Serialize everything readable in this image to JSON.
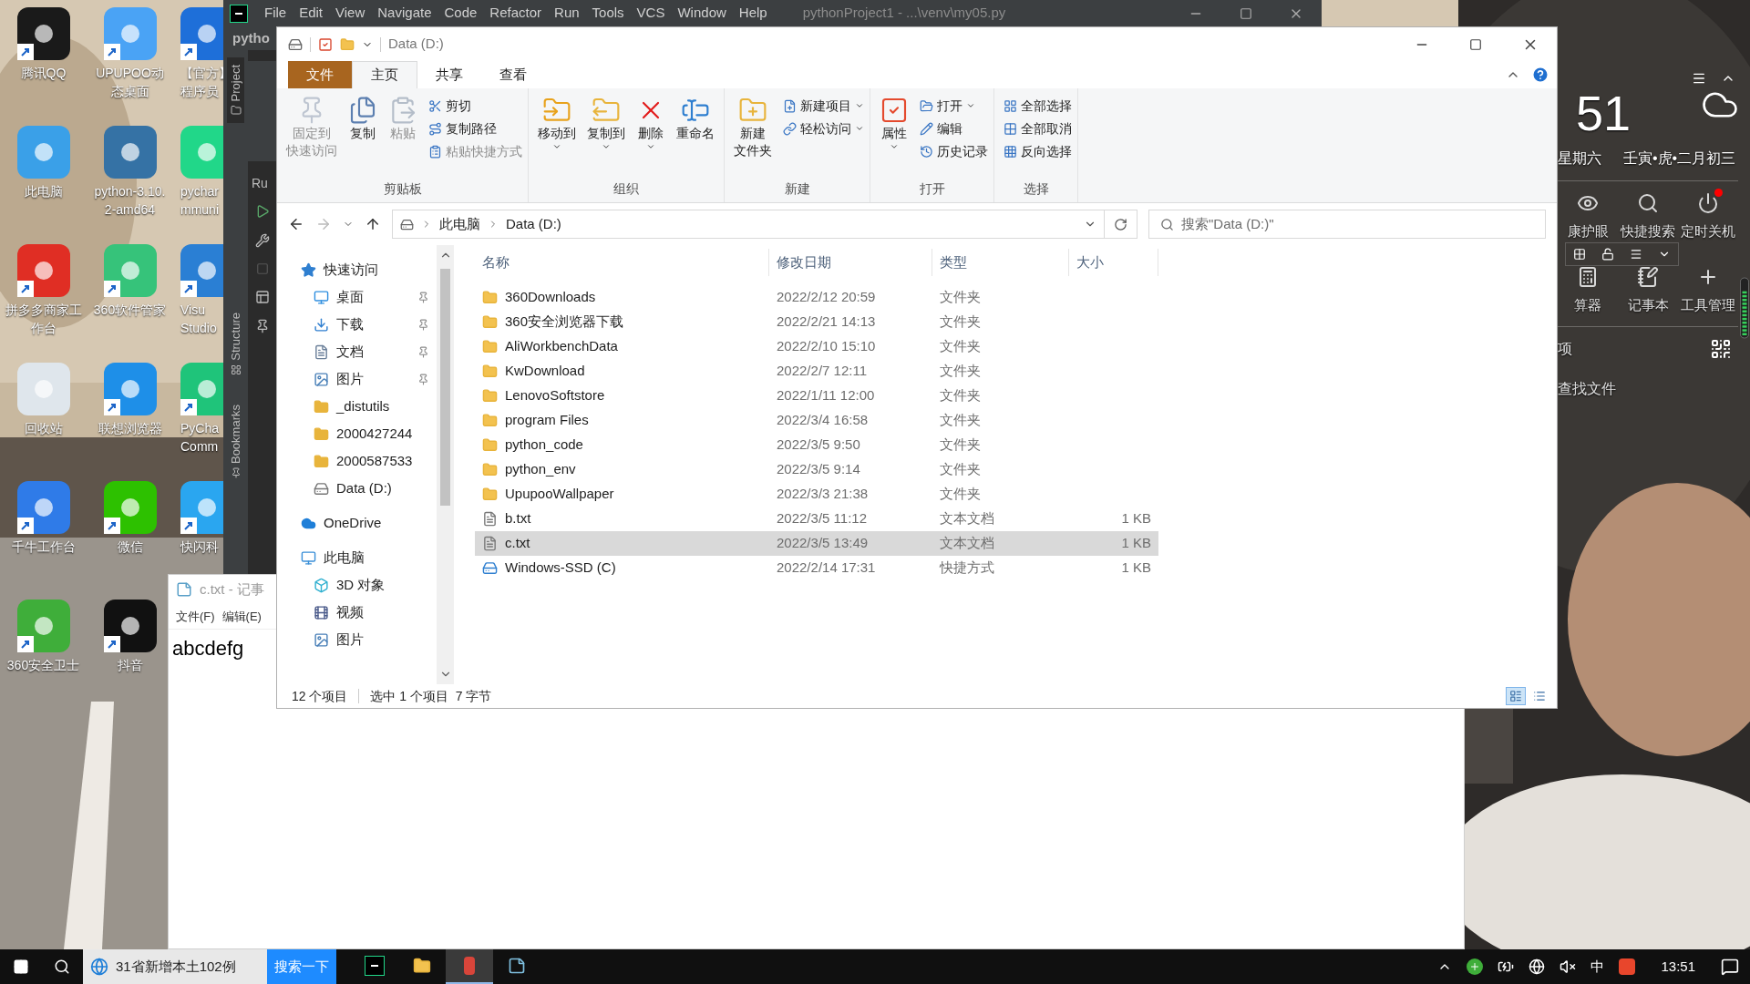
{
  "desktop": {
    "columns": [
      [
        {
          "lines": [
            "腾讯QQ"
          ],
          "color": "#1a1a1a",
          "shortcut": true
        },
        {
          "lines": [
            "此电脑"
          ],
          "color": "#3aa0e8",
          "shortcut": false
        },
        {
          "lines": [
            "拼多多商家工",
            "作台"
          ],
          "color": "#e02e24",
          "shortcut": true
        },
        {
          "lines": [
            "回收站"
          ],
          "color": "#dfe6ec",
          "shortcut": false
        },
        {
          "lines": [
            "千牛工作台"
          ],
          "color": "#2f7be8",
          "shortcut": true
        },
        {
          "lines": [
            "360安全卫士"
          ],
          "color": "#3fae3a",
          "shortcut": true
        }
      ],
      [
        {
          "lines": [
            "UPUPOO动",
            "态桌面"
          ],
          "color": "#4aa3f5",
          "shortcut": true
        },
        {
          "lines": [
            "python-3.10.",
            "2-amd64"
          ],
          "color": "#3572a5",
          "shortcut": false
        },
        {
          "lines": [
            "360软件管家"
          ],
          "color": "#36c37a",
          "shortcut": true
        },
        {
          "lines": [
            "联想浏览器"
          ],
          "color": "#1e8fe8",
          "shortcut": true
        },
        {
          "lines": [
            "微信"
          ],
          "color": "#2dc100",
          "shortcut": true
        },
        {
          "lines": [
            "抖音"
          ],
          "color": "#111111",
          "shortcut": true
        }
      ],
      [
        {
          "lines": [
            "【官方】",
            "程序员"
          ],
          "color": "#1e6fd9",
          "shortcut": true
        },
        {
          "lines": [
            "pychar",
            "mmuni"
          ],
          "color": "#21d789",
          "shortcut": false
        },
        {
          "lines": [
            "Visu",
            "Studio"
          ],
          "color": "#2a7fd4",
          "shortcut": true
        },
        {
          "lines": [
            "PyCha",
            "Comm"
          ],
          "color": "#1fc47a",
          "shortcut": true
        },
        {
          "lines": [
            "快闪科"
          ],
          "color": "#2aa6f0",
          "shortcut": true
        }
      ]
    ]
  },
  "pycharm": {
    "menu": [
      "File",
      "Edit",
      "View",
      "Navigate",
      "Code",
      "Refactor",
      "Run",
      "Tools",
      "VCS",
      "Window",
      "Help"
    ],
    "title": "pythonProject1 - ...\\venv\\my05.py",
    "project_tab": "pytho",
    "tool_tabs": [
      {
        "label": "Project",
        "selected": true
      },
      {
        "label": "Structure",
        "selected": false
      },
      {
        "label": "Bookmarks",
        "selected": false
      }
    ],
    "run_tab": "Ru"
  },
  "notepad": {
    "title": "c.txt - 记事",
    "menu": [
      "文件(F)",
      "编辑(E)"
    ],
    "text": "abcdefg"
  },
  "explorer": {
    "title": "Data (D:)",
    "file_tab": "文件",
    "tabs": [
      {
        "label": "主页",
        "selected": true
      },
      {
        "label": "共享",
        "selected": false
      },
      {
        "label": "查看",
        "selected": false
      }
    ],
    "ribbon": [
      {
        "label": "剪贴板",
        "large": [
          {
            "lines": [
              "固定到",
              "快速访问"
            ],
            "disabled": true,
            "dropdown": false
          },
          {
            "lines": [
              "复制"
            ],
            "disabled": false,
            "dropdown": false
          },
          {
            "lines": [
              "粘贴"
            ],
            "disabled": true,
            "dropdown": false
          }
        ],
        "small": [
          {
            "label": "剪切",
            "disabled": false,
            "dropdown": false
          },
          {
            "label": "复制路径",
            "disabled": false,
            "dropdown": false
          },
          {
            "label": "粘贴快捷方式",
            "disabled": true,
            "dropdown": false
          }
        ]
      },
      {
        "label": "组织",
        "large": [
          {
            "lines": [
              "移动到"
            ],
            "disabled": false,
            "dropdown": true
          },
          {
            "lines": [
              "复制到"
            ],
            "disabled": false,
            "dropdown": true
          },
          {
            "lines": [
              "删除"
            ],
            "disabled": false,
            "dropdown": true
          },
          {
            "lines": [
              "重命名"
            ],
            "disabled": false,
            "dropdown": false
          }
        ]
      },
      {
        "label": "新建",
        "large": [
          {
            "lines": [
              "新建",
              "文件夹"
            ],
            "disabled": false,
            "dropdown": false
          }
        ],
        "small": [
          {
            "label": "新建项目",
            "disabled": false,
            "dropdown": true
          },
          {
            "label": "轻松访问",
            "disabled": false,
            "dropdown": true
          }
        ]
      },
      {
        "label": "打开",
        "large": [
          {
            "lines": [
              "属性"
            ],
            "disabled": false,
            "dropdown": true
          }
        ],
        "small": [
          {
            "label": "打开",
            "disabled": false,
            "dropdown": true
          },
          {
            "label": "编辑",
            "disabled": false,
            "dropdown": false
          },
          {
            "label": "历史记录",
            "disabled": false,
            "dropdown": false
          }
        ]
      },
      {
        "label": "选择",
        "small": [
          {
            "label": "全部选择",
            "disabled": false,
            "dropdown": false
          },
          {
            "label": "全部取消",
            "disabled": false,
            "dropdown": false
          },
          {
            "label": "反向选择",
            "disabled": false,
            "dropdown": false
          }
        ]
      }
    ],
    "path": [
      "此电脑",
      "Data (D:)"
    ],
    "search": {
      "placeholder": "搜索\"Data (D:)\""
    },
    "nav": [
      {
        "label": "快速访问",
        "kind": "quick",
        "pinned": false,
        "children": [
          {
            "label": "桌面",
            "kind": "desktop",
            "pinned": true
          },
          {
            "label": "下载",
            "kind": "download",
            "pinned": true
          },
          {
            "label": "文档",
            "kind": "docs",
            "pinned": true
          },
          {
            "label": "图片",
            "kind": "pictures",
            "pinned": true
          },
          {
            "label": "_distutils",
            "kind": "folder",
            "pinned": false
          },
          {
            "label": "2000427244",
            "kind": "folder",
            "pinned": false
          },
          {
            "label": "2000587533",
            "kind": "folder",
            "pinned": false
          },
          {
            "label": "Data (D:)",
            "kind": "drive",
            "pinned": false
          }
        ]
      },
      {
        "label": "OneDrive",
        "kind": "cloud",
        "pinned": false
      },
      {
        "label": "此电脑",
        "kind": "pc",
        "pinned": false,
        "children": [
          {
            "label": "3D 对象",
            "kind": "objects",
            "pinned": false
          },
          {
            "label": "视频",
            "kind": "videos",
            "pinned": false
          },
          {
            "label": "图片",
            "kind": "pictures",
            "pinned": false
          }
        ]
      }
    ],
    "columns": [
      "名称",
      "修改日期",
      "类型",
      "大小"
    ],
    "rows": [
      {
        "name": "360Downloads",
        "date": "2022/2/12 20:59",
        "type": "文件夹",
        "kind": "folder",
        "selected": false
      },
      {
        "name": "360安全浏览器下载",
        "date": "2022/2/21 14:13",
        "type": "文件夹",
        "kind": "folder",
        "selected": false
      },
      {
        "name": "AliWorkbenchData",
        "date": "2022/2/10 15:10",
        "type": "文件夹",
        "kind": "folder",
        "selected": false
      },
      {
        "name": "KwDownload",
        "date": "2022/2/7 12:11",
        "type": "文件夹",
        "kind": "folder",
        "selected": false
      },
      {
        "name": "LenovoSoftstore",
        "date": "2022/1/11 12:00",
        "type": "文件夹",
        "kind": "folder",
        "selected": false
      },
      {
        "name": "program Files",
        "date": "2022/3/4 16:58",
        "type": "文件夹",
        "kind": "folder",
        "selected": false
      },
      {
        "name": "python_code",
        "date": "2022/3/5 9:50",
        "type": "文件夹",
        "kind": "folder",
        "selected": false
      },
      {
        "name": "python_env",
        "date": "2022/3/5 9:14",
        "type": "文件夹",
        "kind": "folder",
        "selected": false
      },
      {
        "name": "UpupooWallpaper",
        "date": "2022/3/3 21:38",
        "type": "文件夹",
        "kind": "folder",
        "selected": false
      },
      {
        "name": "b.txt",
        "date": "2022/3/5 11:12",
        "type": "文本文档",
        "size": "1 KB",
        "kind": "text",
        "selected": false
      },
      {
        "name": "c.txt",
        "date": "2022/3/5 13:49",
        "type": "文本文档",
        "size": "1 KB",
        "kind": "text",
        "selected": true
      },
      {
        "name": "Windows-SSD (C)",
        "date": "2022/2/14 17:31",
        "type": "快捷方式",
        "size": "1 KB",
        "kind": "shortcut",
        "selected": false
      }
    ],
    "status": {
      "count": "12 个项目",
      "selection": "选中 1 个项目  7 字节"
    },
    "views": [
      {
        "selected": true
      },
      {
        "selected": false
      }
    ]
  },
  "widget": {
    "minutes": "51",
    "weekday": "星期六",
    "lunar": "壬寅•虎•二月初三",
    "tools": [
      {
        "label": "康护眼",
        "alert": false
      },
      {
        "label": "快捷搜索",
        "alert": false
      },
      {
        "label": "定时关机",
        "alert": true
      },
      {
        "label": "算器",
        "alert": false
      },
      {
        "label": "记事本",
        "alert": false
      },
      {
        "label": "工具管理",
        "alert": false
      }
    ],
    "item": "项",
    "find": "查找文件"
  },
  "taskbar": {
    "news": "31省新增本土102例",
    "search_button": "搜索一下",
    "apps": [
      {
        "active": false
      },
      {
        "active": false
      },
      {
        "active": true
      },
      {
        "active": false
      }
    ],
    "ime": "中",
    "time": "13:51"
  }
}
